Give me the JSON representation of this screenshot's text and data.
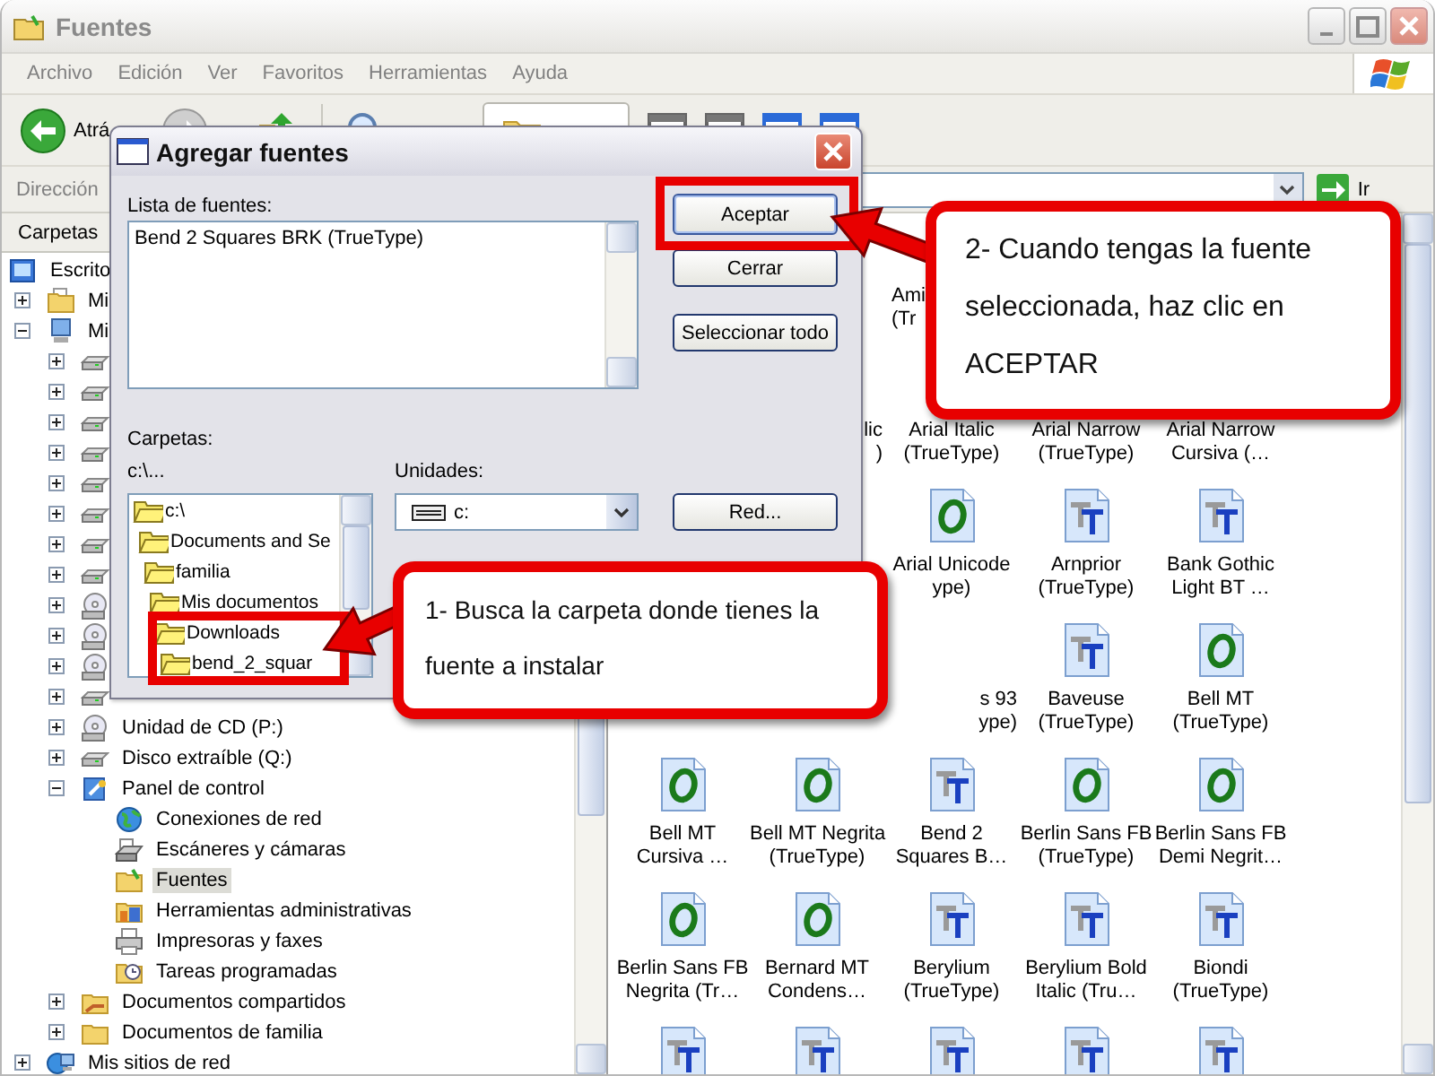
{
  "window": {
    "title": "Fuentes"
  },
  "menu": [
    "Archivo",
    "Edición",
    "Ver",
    "Favoritos",
    "Herramientas",
    "Ayuda"
  ],
  "toolbar": {
    "back_label": "Atrá"
  },
  "address_bar": {
    "label": "Dirección",
    "go_label": "Ir"
  },
  "folders_pane": {
    "title": "Carpetas",
    "tree": [
      {
        "label": "Escrito",
        "kind": "desktop",
        "selected": false,
        "children": [
          {
            "label": "Mi",
            "kind": "documents",
            "expanded": false,
            "selected": false
          },
          {
            "label": "Mi",
            "kind": "computer",
            "expanded": true,
            "selected": false,
            "children": [
              {
                "kind": "drive",
                "expanded": false
              },
              {
                "kind": "drive",
                "expanded": false
              },
              {
                "kind": "drive",
                "expanded": false
              },
              {
                "kind": "drive",
                "expanded": false
              },
              {
                "kind": "drive",
                "expanded": false
              },
              {
                "kind": "drive",
                "expanded": false
              },
              {
                "kind": "drive",
                "expanded": false
              },
              {
                "kind": "drive",
                "expanded": false
              },
              {
                "kind": "cd",
                "expanded": false
              },
              {
                "kind": "cd",
                "expanded": false
              },
              {
                "kind": "cd",
                "expanded": false
              },
              {
                "kind": "drive",
                "expanded": false
              },
              {
                "label": "Unidad de CD (P:)",
                "kind": "cd",
                "expanded": false,
                "selected": false
              },
              {
                "label": "Disco extraíble (Q:)",
                "kind": "drive",
                "expanded": false,
                "selected": false
              },
              {
                "label": "Panel de control",
                "kind": "control_panel",
                "expanded": true,
                "selected": false,
                "children": [
                  {
                    "label": "Conexiones de red",
                    "kind": "network",
                    "selected": false
                  },
                  {
                    "label": "Escáneres y cámaras",
                    "kind": "scanner",
                    "selected": false
                  },
                  {
                    "label": "Fuentes",
                    "kind": "fonts",
                    "selected": true
                  },
                  {
                    "label": "Herramientas administrativas",
                    "kind": "admin",
                    "selected": false
                  },
                  {
                    "label": "Impresoras y faxes",
                    "kind": "printer",
                    "selected": false
                  },
                  {
                    "label": "Tareas programadas",
                    "kind": "tasks",
                    "selected": false
                  }
                ]
              },
              {
                "label": "Documentos compartidos",
                "kind": "shared_folder",
                "expanded": false,
                "selected": false
              },
              {
                "label": "Documentos de familia",
                "kind": "folder",
                "expanded": false,
                "selected": false
              }
            ]
          },
          {
            "label": "Mis sitios de red",
            "kind": "network_places",
            "expanded": false,
            "selected": false
          }
        ]
      }
    ]
  },
  "fonts": [
    {
      "kind": "covered"
    },
    {
      "kind": "covered"
    },
    {
      "kind": "head",
      "lines": [
        "Ami",
        "(Tr"
      ]
    },
    {
      "kind": "covered"
    },
    {
      "kind": "covered"
    },
    {
      "kind": "covered"
    },
    {
      "kind": "tail",
      "lines": [
        "lic",
        ")"
      ]
    },
    {
      "kind": "caption",
      "lines": [
        "Arial Italic",
        "(TrueType)"
      ]
    },
    {
      "kind": "caption",
      "lines": [
        "Arial Narrow",
        "(TrueType)"
      ]
    },
    {
      "kind": "caption",
      "lines": [
        "Arial Narrow",
        "Cursiva (…"
      ]
    },
    {
      "kind": "covered"
    },
    {
      "kind": "covered"
    },
    {
      "kind": "opentype",
      "lines": [
        "Arial Unicode",
        "ype)"
      ]
    },
    {
      "kind": "truetype",
      "lines": [
        "Arnprior",
        "(TrueType)"
      ]
    },
    {
      "kind": "truetype",
      "lines": [
        "Bank Gothic",
        "Light BT …"
      ]
    },
    {
      "kind": "covered"
    },
    {
      "kind": "covered"
    },
    {
      "kind": "tail",
      "lines": [
        "s 93",
        "ype)"
      ]
    },
    {
      "kind": "truetype",
      "lines": [
        "Baveuse",
        "(TrueType)"
      ]
    },
    {
      "kind": "opentype",
      "lines": [
        "Bell MT",
        "(TrueType)"
      ]
    },
    {
      "kind": "opentype",
      "lines": [
        "Bell MT",
        "Cursiva …"
      ]
    },
    {
      "kind": "opentype",
      "lines": [
        "Bell MT Negrita",
        "(TrueType)"
      ]
    },
    {
      "kind": "truetype",
      "lines": [
        "Bend 2",
        "Squares B…"
      ]
    },
    {
      "kind": "opentype",
      "lines": [
        "Berlin Sans FB",
        "(TrueType)"
      ]
    },
    {
      "kind": "opentype",
      "lines": [
        "Berlin Sans FB",
        "Demi Negrit…"
      ]
    },
    {
      "kind": "opentype",
      "lines": [
        "Berlin Sans FB",
        "Negrita (Tr…"
      ]
    },
    {
      "kind": "opentype",
      "lines": [
        "Bernard MT",
        "Condens…"
      ]
    },
    {
      "kind": "truetype",
      "lines": [
        "Berylium",
        "(TrueType)"
      ]
    },
    {
      "kind": "truetype",
      "lines": [
        "Berylium Bold",
        "Italic (Tru…"
      ]
    },
    {
      "kind": "truetype",
      "lines": [
        "Biondi",
        "(TrueType)"
      ]
    },
    {
      "kind": "truetype"
    },
    {
      "kind": "truetype"
    },
    {
      "kind": "truetype"
    },
    {
      "kind": "truetype"
    },
    {
      "kind": "truetype"
    }
  ],
  "dialog": {
    "title": "Agregar fuentes",
    "list_label": "Lista de fuentes:",
    "font_list": [
      "Bend 2 Squares BRK (TrueType)"
    ],
    "buttons": [
      "Aceptar",
      "Cerrar",
      "Seleccionar todo"
    ],
    "folders_label": "Carpetas:",
    "path": "c:\\...",
    "folders": [
      {
        "label": "c:\\",
        "children": [
          {
            "label": "Documents and Se",
            "children": [
              {
                "label": "familia",
                "children": [
                  {
                    "label": "Mis documentos",
                    "children": [
                      {
                        "label": "Downloads",
                        "children": [
                          {
                            "label": "bend_2_squar"
                          }
                        ]
                      }
                    ]
                  }
                ]
              }
            ]
          }
        ]
      }
    ],
    "drives_label": "Unidades:",
    "drive": "c:",
    "network_button": "Red..."
  },
  "callouts": [
    {
      "kind": "accept",
      "text": "2- Cuando tengas la fuente seleccionada, haz clic en ACEPTAR"
    },
    {
      "kind": "folder",
      "text": "1- Busca la carpeta donde tienes la fuente a instalar"
    }
  ]
}
